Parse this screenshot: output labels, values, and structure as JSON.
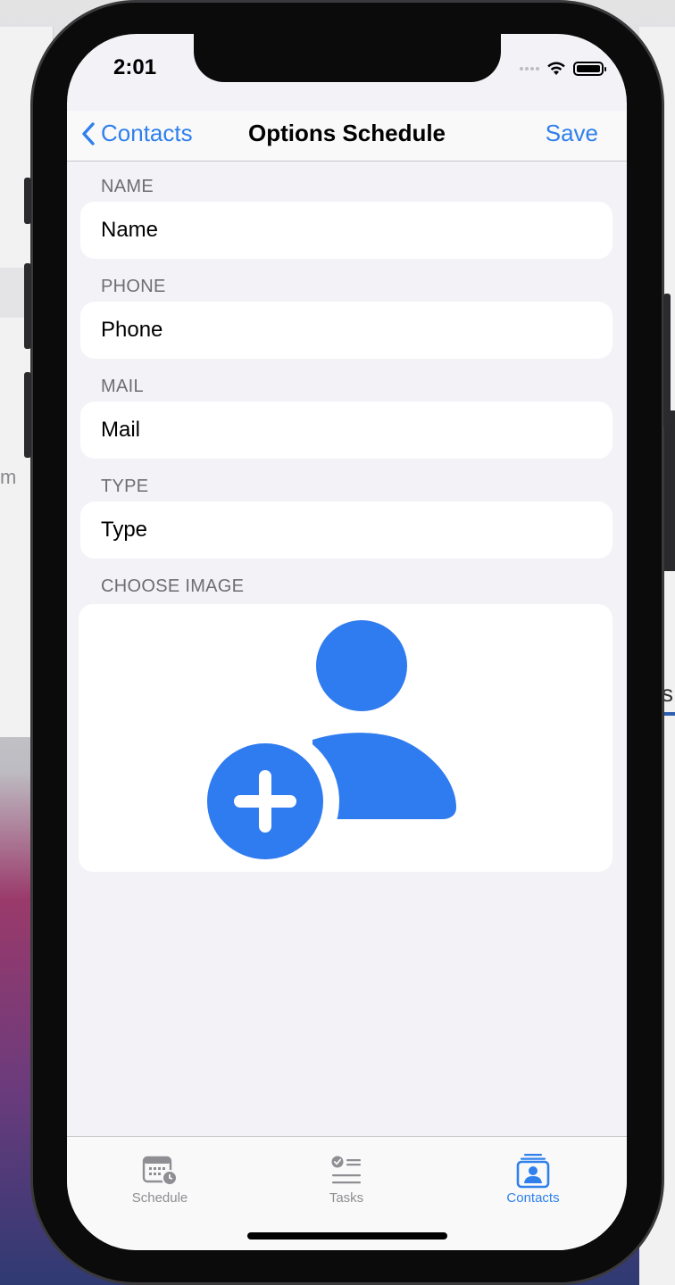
{
  "status_bar": {
    "time": "2:01"
  },
  "navbar": {
    "back_label": "Contacts",
    "title": "Options Schedule",
    "save_label": "Save"
  },
  "form": {
    "name": {
      "label": "NAME",
      "placeholder": "Name",
      "value": ""
    },
    "phone": {
      "label": "PHONE",
      "placeholder": "Phone",
      "value": ""
    },
    "mail": {
      "label": "MAIL",
      "placeholder": "Mail",
      "value": ""
    },
    "type": {
      "label": "TYPE",
      "placeholder": "Type",
      "value": ""
    },
    "image": {
      "label": "CHOOSE IMAGE",
      "icon": "person-add-icon"
    }
  },
  "tabbar": {
    "items": [
      {
        "label": "Schedule",
        "icon": "calendar-clock-icon",
        "active": false
      },
      {
        "label": "Tasks",
        "icon": "checklist-icon",
        "active": false
      },
      {
        "label": "Contacts",
        "icon": "contact-card-icon",
        "active": true
      }
    ]
  },
  "colors": {
    "accent": "#2f80ed",
    "icon_blue": "#2f7bf0",
    "background": "#f2f2f7",
    "inactive_tab": "#8e8e93"
  },
  "background_text": {
    "left_fragment": "m",
    "right_fragment": "is"
  }
}
